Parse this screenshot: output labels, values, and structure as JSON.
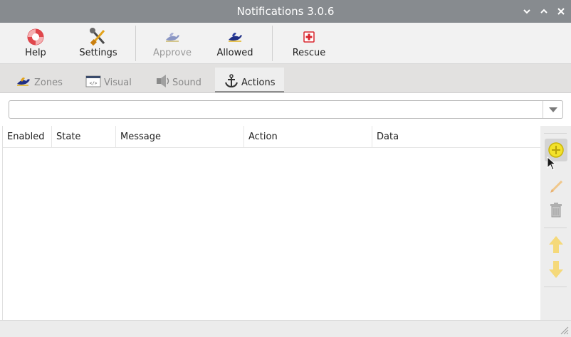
{
  "window": {
    "title": "Notifications 3.0.6"
  },
  "titlebar": {
    "minimize": "⌄",
    "maximize": "⌃",
    "close": "✕"
  },
  "toolbar": {
    "help": "Help",
    "settings": "Settings",
    "approve": "Approve",
    "allowed": "Allowed",
    "rescue": "Rescue"
  },
  "tabs": [
    {
      "label": "Zones",
      "active": false
    },
    {
      "label": "Visual",
      "active": false
    },
    {
      "label": "Sound",
      "active": false
    },
    {
      "label": "Actions",
      "active": true
    }
  ],
  "filter": {
    "value": ""
  },
  "table": {
    "columns": [
      "Enabled",
      "State",
      "Message",
      "Action",
      "Data"
    ],
    "rows": []
  },
  "colors": {
    "titlebar": "#878b8f",
    "add": "#f3e22a",
    "arrows": "#f5d97a",
    "rescue": "#d9262e"
  },
  "icons": {
    "help": "lifebuoy-icon",
    "settings": "tools-icon",
    "approve": "duck-icon",
    "allowed": "duck-icon",
    "rescue": "first-aid-icon",
    "zones": "duck-icon",
    "visual": "code-window-icon",
    "sound": "speaker-icon",
    "actions": "anchor-icon"
  }
}
